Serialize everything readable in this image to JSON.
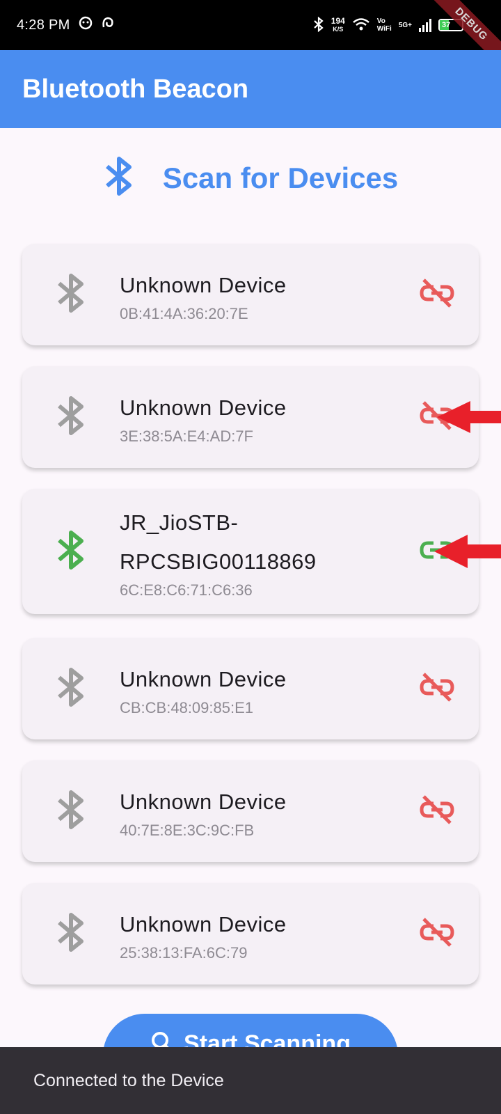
{
  "status_bar": {
    "time": "4:28 PM",
    "net_speed": "194",
    "net_unit": "K/S",
    "vo": "Vo",
    "wifi": "WiFi",
    "network": "5G+",
    "battery": "37",
    "debug": "DEBUG"
  },
  "app_bar": {
    "title": "Bluetooth Beacon"
  },
  "heading": {
    "title": "Scan for Devices",
    "icon": "bluetooth-icon"
  },
  "devices": [
    {
      "name": "Unknown Device",
      "address": "0B:41:4A:36:20:7E",
      "connected": false
    },
    {
      "name": "Unknown Device",
      "address": "3E:38:5A:E4:AD:7F",
      "connected": false
    },
    {
      "name_line1": "JR_JioSTB-",
      "name_line2": "RPCSBIG00118869",
      "address": "6C:E8:C6:71:C6:36",
      "connected": true
    },
    {
      "name": "Unknown Device",
      "address": "CB:CB:48:09:85:E1",
      "connected": false
    },
    {
      "name": "Unknown Device",
      "address": "40:7E:8E:3C:9C:FB",
      "connected": false
    },
    {
      "name": "Unknown Device",
      "address": "25:38:13:FA:6C:79",
      "connected": false
    }
  ],
  "start_button": {
    "label": "Start Scanning"
  },
  "snackbar": {
    "message": "Connected to the Device"
  },
  "colors": {
    "primary": "#4a8df0",
    "connected": "#4caf50",
    "disconnected": "#e85a5a",
    "inactive_icon": "#9e9e9e",
    "annotation_arrow": "#e8202a"
  }
}
